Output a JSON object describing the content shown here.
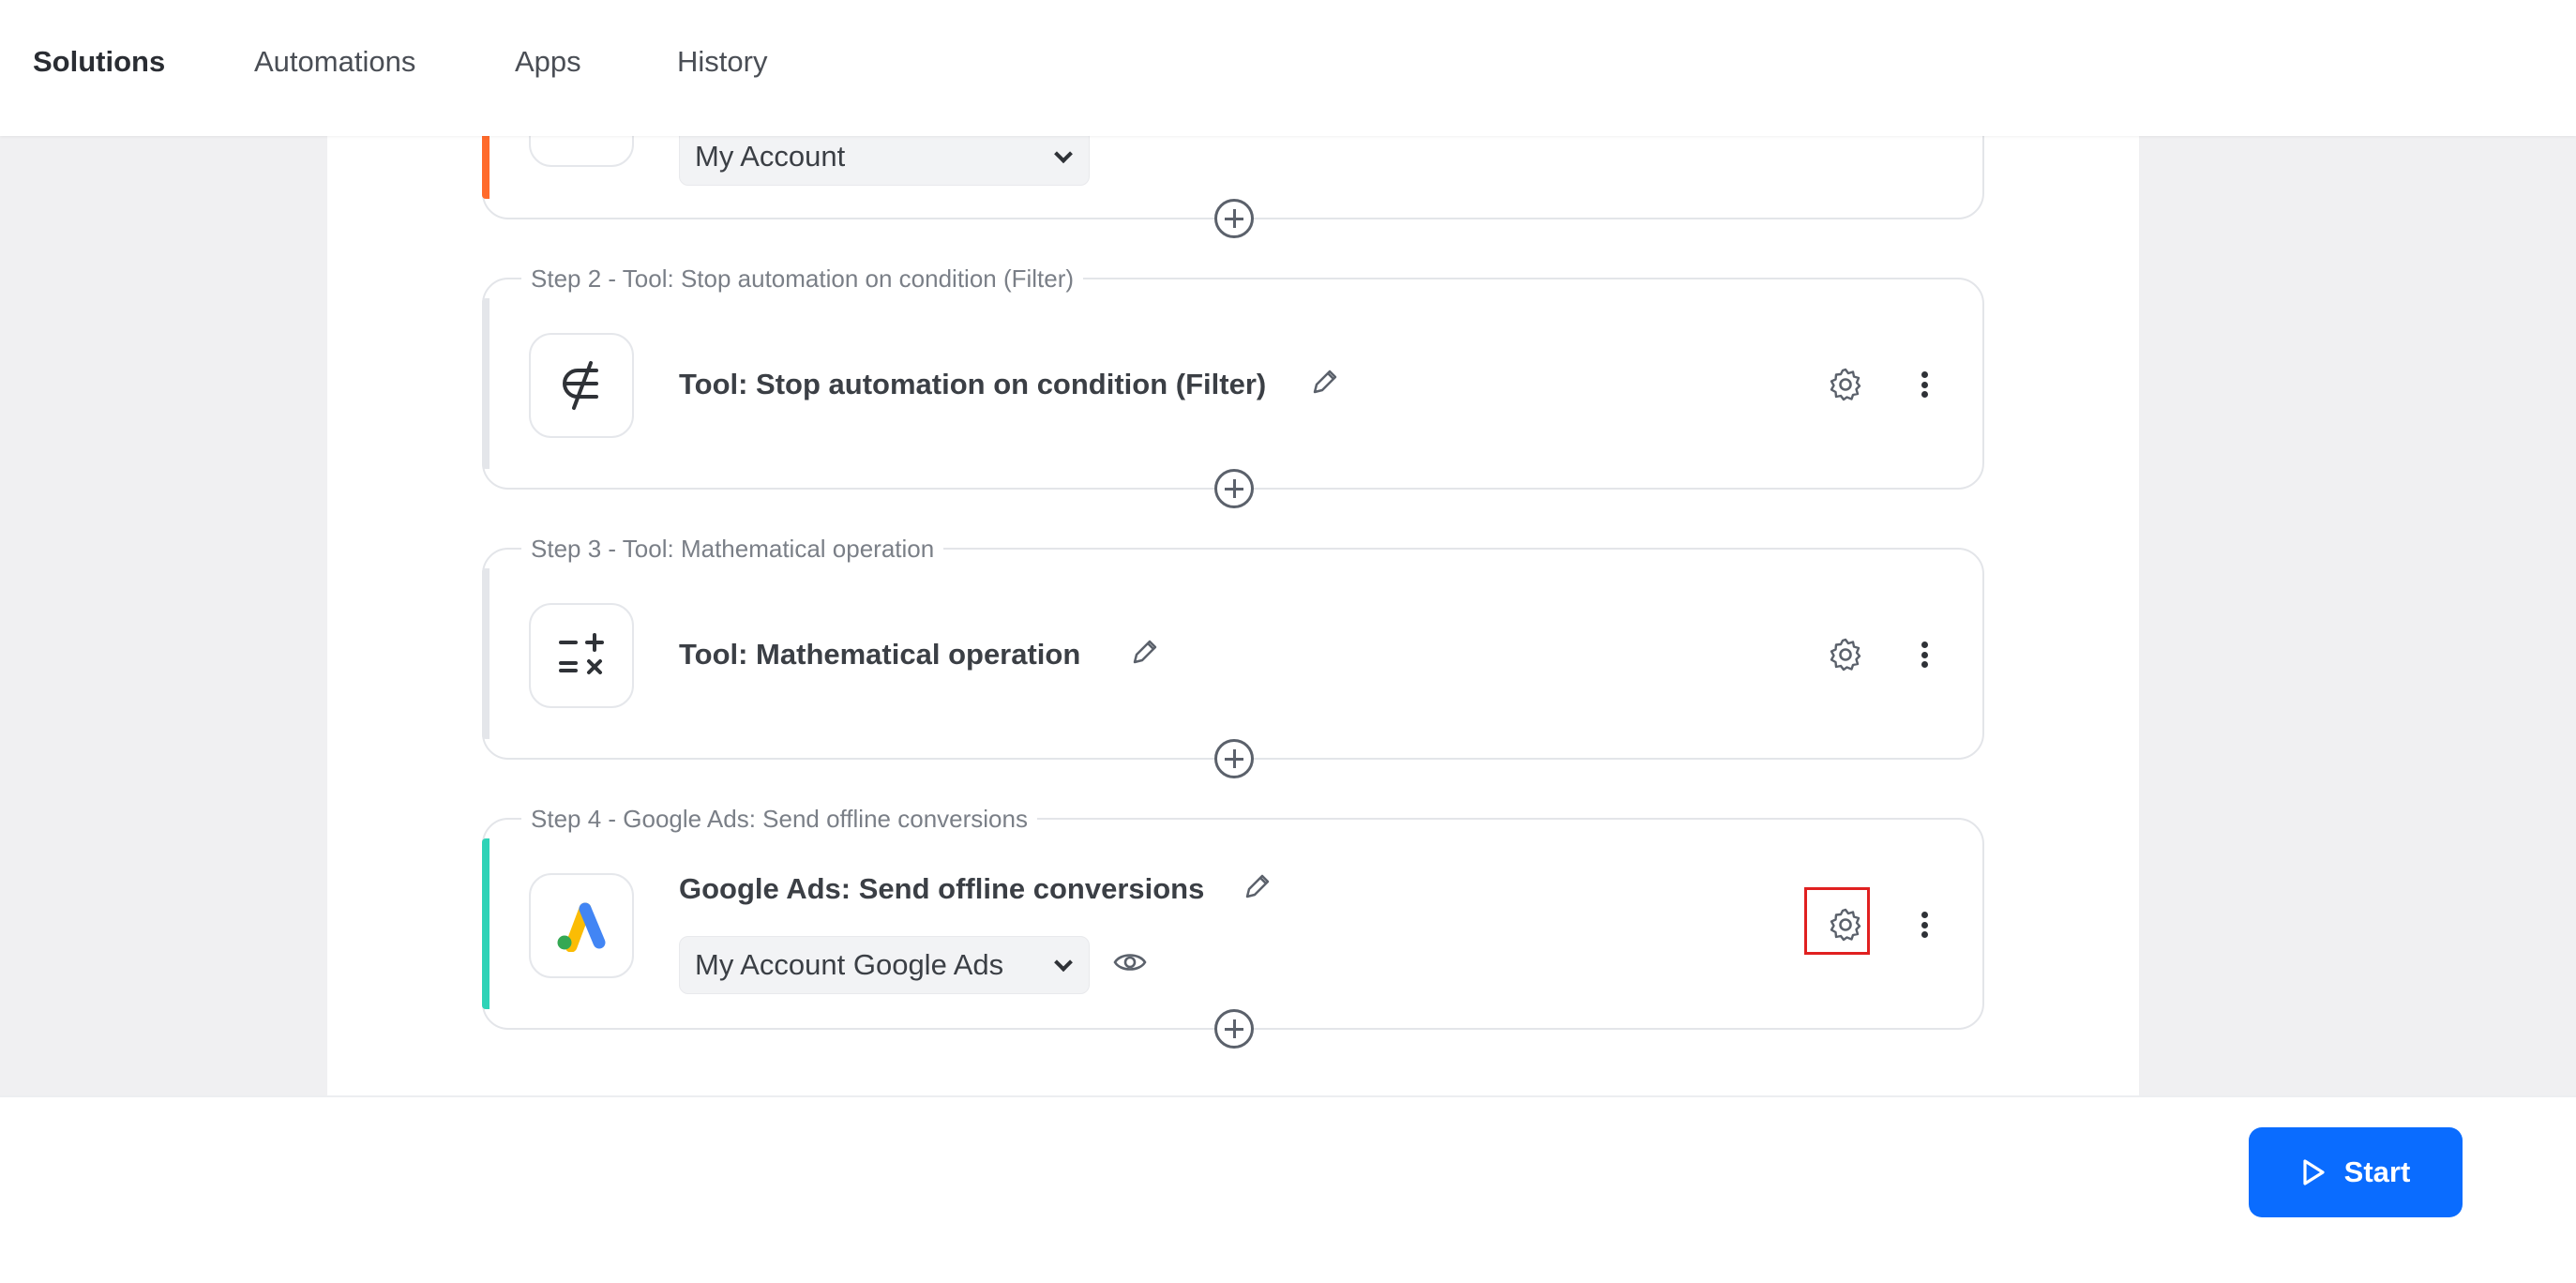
{
  "nav": {
    "items": [
      {
        "label": "Solutions",
        "active": true
      },
      {
        "label": "Automations",
        "active": false
      },
      {
        "label": "Apps",
        "active": false
      },
      {
        "label": "History",
        "active": false
      }
    ]
  },
  "steps": [
    {
      "account_select": "My Account",
      "accent_color": "#ff6a2b"
    },
    {
      "legend": "Step 2 - Tool: Stop automation on condition (Filter)",
      "title": "Tool: Stop automation on condition (Filter)",
      "icon": "filter-not-subset-icon"
    },
    {
      "legend": "Step 3 - Tool: Mathematical operation",
      "title": "Tool: Mathematical operation",
      "icon": "math-operations-icon"
    },
    {
      "legend": "Step 4 - Google Ads: Send offline conversions",
      "title": "Google Ads: Send offline conversions",
      "icon": "google-ads-logo-icon",
      "account_select": "My Account Google Ads",
      "accent_color": "#2ed3b7"
    }
  ],
  "footer": {
    "start_label": "Start"
  },
  "colors": {
    "primary": "#0a6cff",
    "highlight": "#e02020"
  }
}
